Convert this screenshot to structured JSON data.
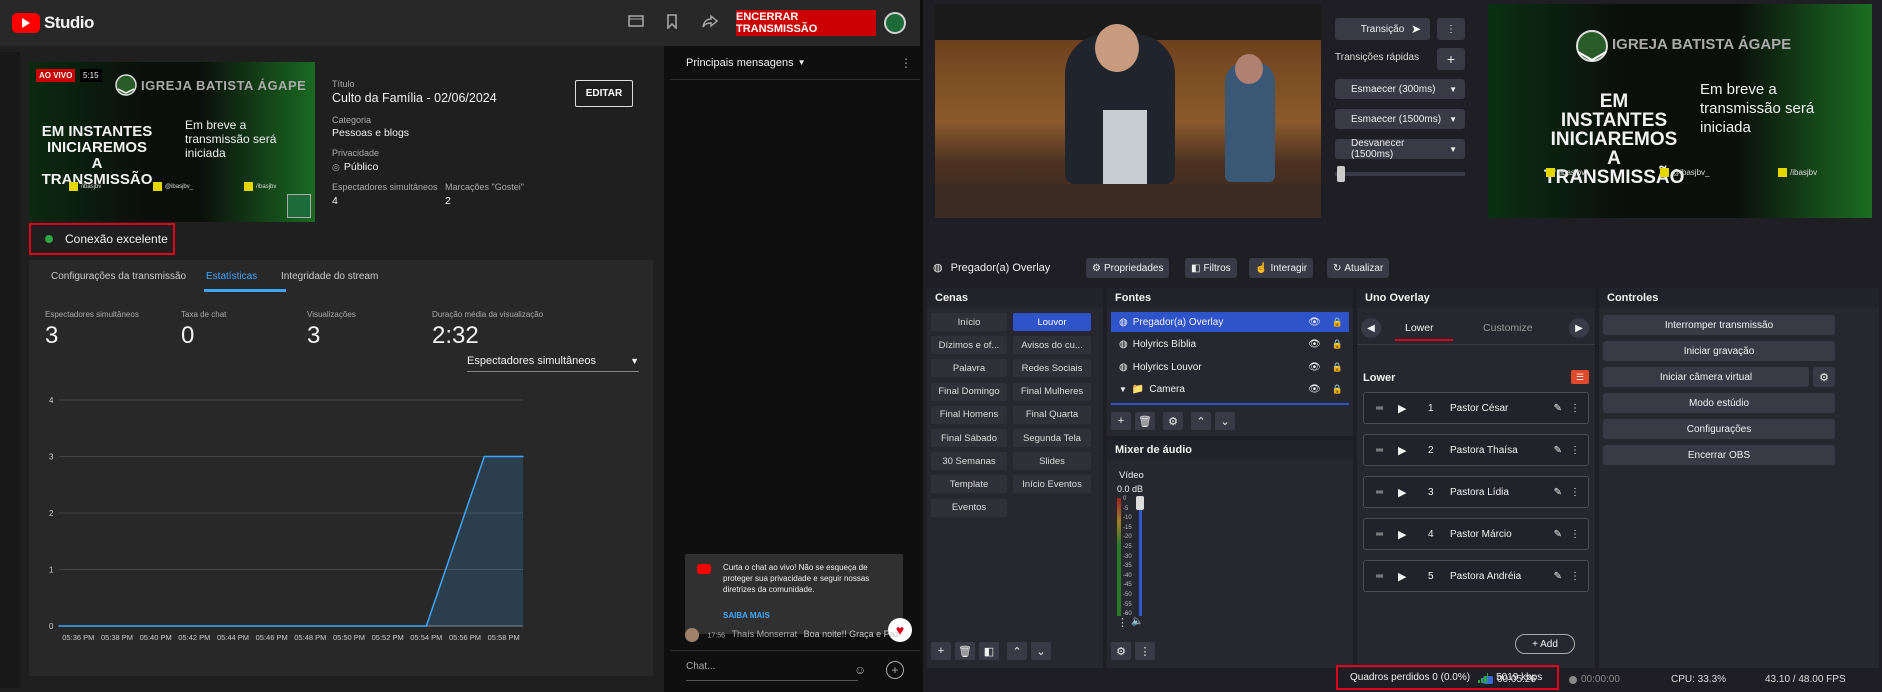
{
  "yt": {
    "logo": "Studio",
    "end_stream": "ENCERRAR TRANSMISSÃO",
    "thumb": {
      "live": "AO VIVO",
      "time": "5:15",
      "church": "IGREJA BATISTA ÁGAPE",
      "big": "EM INSTANTES INICIAREMOS A TRANSMISSÃO",
      "small": "Em breve a transmissão será iniciada",
      "social_1": "/ibasjbv",
      "social_2": "@ibasjbv_",
      "social_3": "/ibasjbv"
    },
    "title_label": "Título",
    "title": "Culto da Família - 02/06/2024",
    "category_label": "Categoria",
    "category": "Pessoas e blogs",
    "privacy_label": "Privacidade",
    "privacy": "Público",
    "viewers_label": "Espectadores simultâneos",
    "viewers": "4",
    "likes_label": "Marcações \"Gostei\"",
    "likes": "2",
    "edit": "EDITAR",
    "connection": "Conexão excelente",
    "tabs": [
      "Configurações da transmissão",
      "Estatísticas",
      "Integridade do stream"
    ],
    "stats": [
      {
        "label": "Espectadores simultâneos",
        "value": "3"
      },
      {
        "label": "Taxa de chat",
        "value": "0"
      },
      {
        "label": "Visualizações",
        "value": "3"
      },
      {
        "label": "Duração média da visualização",
        "value": "2:32"
      }
    ],
    "chart_select": "Espectadores simultâneos"
  },
  "chart_data": {
    "type": "area",
    "x": [
      "05:36 PM",
      "05:38 PM",
      "05:40 PM",
      "05:42 PM",
      "05:44 PM",
      "05:46 PM",
      "05:48 PM",
      "05:50 PM",
      "05:52 PM",
      "05:54 PM",
      "05:56 PM",
      "05:58 PM"
    ],
    "points": [
      {
        "x": "05:35 PM",
        "y": 0
      },
      {
        "x": "05:54 PM",
        "y": 0
      },
      {
        "x": "05:56 PM",
        "y": 2
      },
      {
        "x": "05:57 PM",
        "y": 3
      },
      {
        "x": "05:59 PM",
        "y": 3
      }
    ],
    "yticks": [
      0,
      1,
      2,
      3,
      4
    ],
    "ylim": [
      0,
      4
    ],
    "color": "#3ea6ff"
  },
  "chat": {
    "header": "Principais mensagens",
    "notice": "Curta o chat ao vivo! Não se esqueça de proteger sua privacidade e seguir nossas diretrizes da comunidade.",
    "learn_more": "SAIBA MAIS",
    "msg_time": "17:56",
    "msg_author": "Thaís Monserrat",
    "msg_text": "Boa noite!! Graça e Paz",
    "input_placeholder": "Chat..."
  },
  "obs": {
    "transition": "Transição",
    "quick_transitions": "Transições rápidas",
    "transitions": [
      "Esmaecer (300ms)",
      "Esmaecer (1500ms)",
      "Desvanecer (1500ms)"
    ],
    "preview": {
      "church": "IGREJA BATISTA ÁGAPE",
      "big": "EM INSTANTES INICIAREMOS A TRANSMISSÃO",
      "small": "Em breve a transmissão será iniciada",
      "social_1": "/ibasjbv",
      "social_2": "@ibasjbv_",
      "social_3": "/ibasjbv"
    },
    "selected_source": "Pregador(a) Overlay",
    "ctx": [
      "Propriedades",
      "Filtros",
      "Interagir",
      "Atualizar"
    ],
    "scenes_title": "Cenas",
    "scenes": [
      "Início",
      "Louvor",
      "Dízimos e of...",
      "Avisos do cu...",
      "Palavra",
      "Redes Sociais",
      "Final Domingo",
      "Final Mulheres",
      "Final Homens",
      "Final Quarta",
      "Final Sábado",
      "Segunda Tela",
      "30 Semanas",
      "Slides",
      "Template",
      "Início Eventos",
      "Eventos"
    ],
    "sources_title": "Fontes",
    "sources": [
      "Pregador(a) Overlay",
      "Holyrics Bíblia",
      "Holyrics Louvor",
      "Camera"
    ],
    "mixer_title": "Mixer de áudio",
    "mixer_channel": "Vídeo",
    "mixer_db": "0.0 dB",
    "mixer_ticks": [
      "0",
      "-5",
      "-10",
      "-15",
      "-20",
      "-25",
      "-30",
      "-35",
      "-40",
      "-45",
      "-50",
      "-55",
      "-60"
    ],
    "uno_title": "Uno Overlay",
    "uno_tabs": [
      "Lower",
      "Customize"
    ],
    "uno_section": "Lower",
    "uno_rows": [
      {
        "n": "1",
        "name": "Pastor César"
      },
      {
        "n": "2",
        "name": "Pastora Thaísa"
      },
      {
        "n": "3",
        "name": "Pastora Lídia"
      },
      {
        "n": "4",
        "name": "Pastor Márcio"
      },
      {
        "n": "5",
        "name": "Pastora Andréia"
      }
    ],
    "uno_add": "+ Add",
    "controls_title": "Controles",
    "controls": [
      "Interromper transmissão",
      "Iniciar gravação",
      "Iniciar câmera virtual",
      "Modo estúdio",
      "Configurações",
      "Encerrar OBS"
    ],
    "status": {
      "dropped": "Quadros perdidos 0 (0.0%)",
      "kbps": "5019 kbps",
      "live_time": "00:05:26",
      "rec_time": "00:00:00",
      "cpu": "CPU: 33.3%",
      "fps": "43.10 / 48.00 FPS"
    }
  },
  "colors": {
    "accent_red": "#cc0000",
    "highlight_red": "#e0001b",
    "obs_blue": "#2f53c9",
    "yt_blue": "#3ea6ff"
  }
}
